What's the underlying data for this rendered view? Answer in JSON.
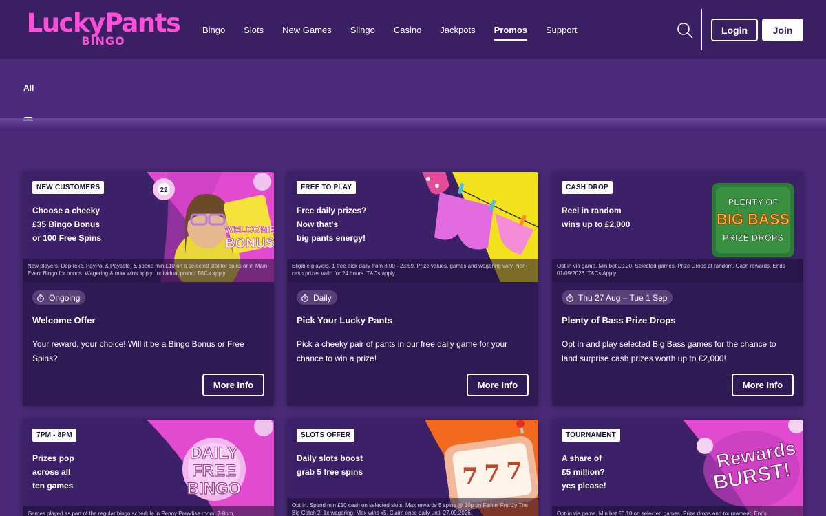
{
  "brand": {
    "logo_main": "LuckyPants",
    "logo_sub": "BINGO",
    "accent": "#ff4fd8"
  },
  "nav": {
    "items": [
      {
        "label": "Bingo"
      },
      {
        "label": "Slots"
      },
      {
        "label": "New Games"
      },
      {
        "label": "Slingo"
      },
      {
        "label": "Casino"
      },
      {
        "label": "Jackpots"
      },
      {
        "label": "Promos",
        "active": true
      },
      {
        "label": "Support"
      }
    ]
  },
  "header": {
    "login_label": "Login",
    "join_label": "Join"
  },
  "filter": {
    "selected": "All"
  },
  "cards": [
    {
      "tag": "NEW CUSTOMERS",
      "headline": [
        "Choose a cheeky",
        "£35 Bingo Bonus",
        "or 100 Free Spins"
      ],
      "fine_print": "New players. Dep (exc. PayPal & Paysafe) & spend min £10 on a selected slot for spins or in Main Event Bingo for bonus. Wagering & max wins apply. Individual promo T&Cs apply.",
      "art_text": [
        "WELCOME",
        "BONUS"
      ],
      "ball_number": "22",
      "badge": "Ongoing",
      "title": "Welcome Offer",
      "description": "Your reward, your choice! Will it be a Bingo Bonus or Free Spins?",
      "button": "More Info"
    },
    {
      "tag": "FREE TO PLAY",
      "headline": [
        "Free daily prizes?",
        "Now that's",
        "big pants energy!"
      ],
      "fine_print": "Eligible players. 1 free pick daily from 8:00 - 23:59. Prize values, games and wagering vary. Non-cash prizes valid for 24 hours. T&Cs apply.",
      "badge": "Daily",
      "title": "Pick Your Lucky Pants",
      "description": "Pick a cheeky pair of pants in our free daily game for your chance to win a prize!",
      "button": "More Info"
    },
    {
      "tag": "CASH DROP",
      "headline": [
        "Reel in random",
        "wins up to £2,000"
      ],
      "fine_print": "Opt in via game. Min bet £0.20. Selected games. Prize Drops at random. Cash rewards. Ends 01/09/2026. T&Cs Apply.",
      "art_text": [
        "PLENTY OF",
        "BIG BASS",
        "PRIZE DROPS"
      ],
      "badge": "Thu 27 Aug – Tue 1 Sep",
      "title": "Plenty of Bass Prize Drops",
      "description": "Opt in and play selected Big Bass games for the chance to land surprise cash prizes worth up to £2,000!",
      "button": "More Info"
    },
    {
      "tag": "7PM - 8PM",
      "headline": [
        "Prizes pop",
        "across all",
        "ten games"
      ],
      "fine_print": "Games played as part of the regular bingo schedule in Penny Paradise room, 7-8pm.",
      "art_text": [
        "DAILY",
        "FREE",
        "BINGO"
      ]
    },
    {
      "tag": "SLOTS OFFER",
      "headline": [
        "Daily slots boost",
        "grab 5 free spins"
      ],
      "fine_print": "Opt in. Spend min £10 cash on selected slots. Max rewards 5 spins @ 10p on Fishin' Frenzy The Big Catch 2. 1x wagering. Max wins x5. Claim once daily until 27.09.2026.",
      "art_text": [
        "7",
        "7",
        "7"
      ]
    },
    {
      "tag": "TOURNAMENT",
      "headline": [
        "A share of",
        "£5 million?",
        "yes please!"
      ],
      "fine_print": "Opt-in via game. Min bet £0.10 on selected games. Prize drops and tournament. Ends",
      "art_text": [
        "Rewards",
        "BURST!"
      ]
    }
  ]
}
